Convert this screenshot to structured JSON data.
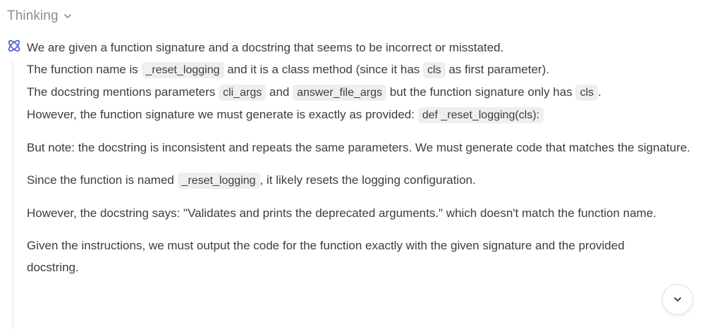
{
  "header": {
    "title": "Thinking",
    "toggle_icon": "chevron-down-icon"
  },
  "thought_icon": "atom-icon",
  "block1": {
    "l1": "We are given a function signature and a docstring that seems to be incorrect or misstated.",
    "l2a": "The function name is ",
    "l2code": "_reset_logging",
    "l2b": " and it is a class method (since it has ",
    "l2code2": "cls",
    "l2c": " as first parameter).",
    "l3a": "The docstring mentions parameters ",
    "l3code": "cli_args",
    "l3b": " and ",
    "l3code2": "answer_file_args",
    "l3c": " but the function signature only has ",
    "l3code3": "cls",
    "l3d": ".",
    "l4a": "However, the function signature we must generate is exactly as provided: ",
    "l4code": "def _reset_logging(cls):"
  },
  "para2": "But note: the docstring is inconsistent and repeats the same parameters. We must generate code that matches the signature.",
  "para3": {
    "a": "Since the function is named ",
    "code": "_reset_logging",
    "b": ", it likely resets the logging configuration."
  },
  "para4": "However, the docstring says: \"Validates and prints the deprecated arguments.\" which doesn't match the function name.",
  "para5": "Given the instructions, we must output the code for the function exactly with the given signature and the provided docstring.",
  "scroll_button_icon": "chevron-down-icon",
  "colors": {
    "text": "#3d3d3d",
    "header": "#8f8f8f",
    "code_bg": "#efefef",
    "accent": "#4f5bd5"
  }
}
